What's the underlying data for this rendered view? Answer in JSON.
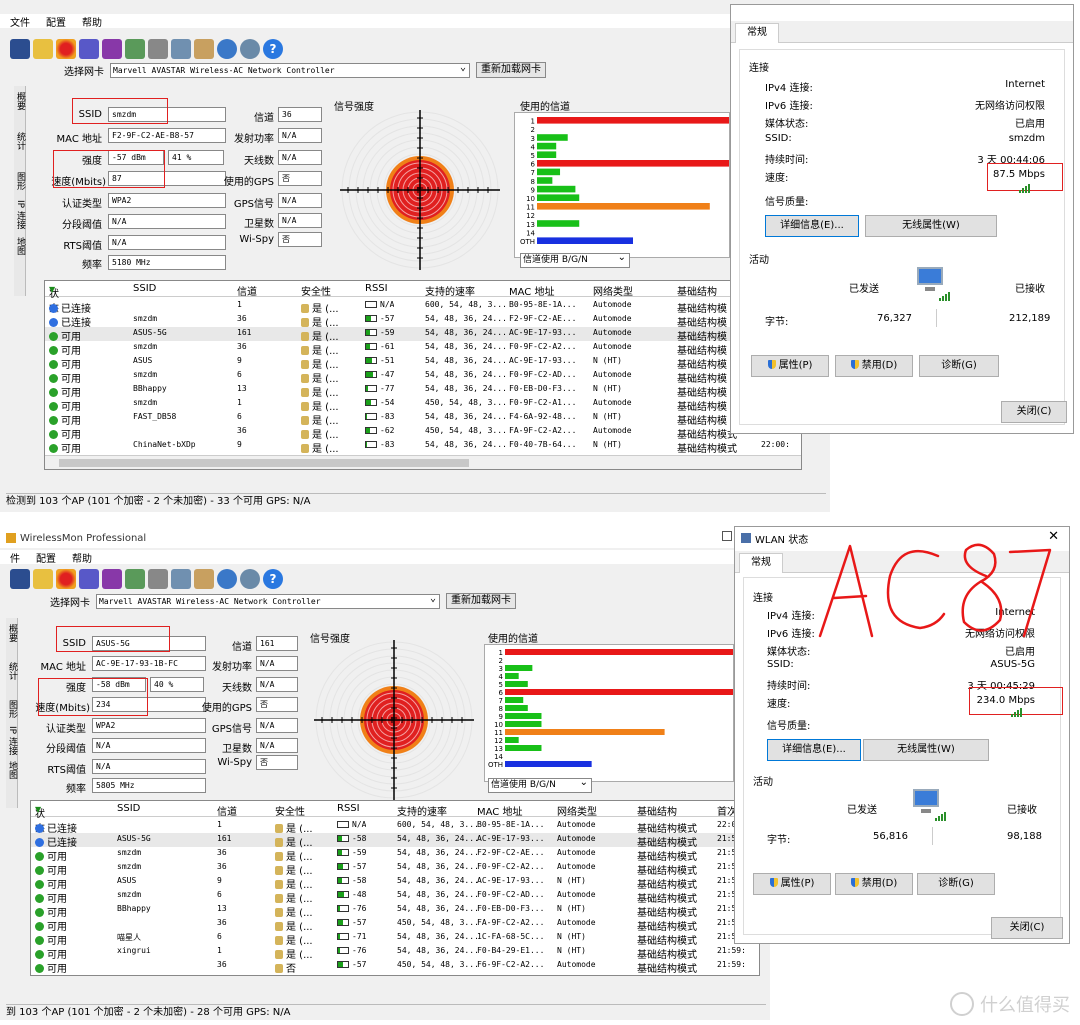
{
  "top": {
    "menu": [
      "文件",
      "配置",
      "帮助"
    ],
    "nic_label": "选择网卡",
    "nic_value": "Marvell AVASTAR Wireless-AC Network Controller",
    "reload_btn": "重新加载网卡",
    "side_tabs": [
      "概要",
      "统计",
      "图形",
      "IP 连接",
      "地图"
    ],
    "fields": {
      "ssid_l": "SSID",
      "ssid": "smzdm",
      "mac_l": "MAC 地址",
      "mac": "F2-9F-C2-AE-B8-57",
      "strength_l": "强度",
      "strength": "-57 dBm",
      "strength_pct": "41 %",
      "speed_l": "速度(Mbits)",
      "speed": "87",
      "auth_l": "认证类型",
      "auth": "WPA2",
      "frag_l": "分段阈值",
      "frag": "N/A",
      "rts_l": "RTS阈值",
      "rts": "N/A",
      "freq_l": "频率",
      "freq": "5180 MHz",
      "channel_l": "信道",
      "channel": "36",
      "txpower_l": "发射功率",
      "txpower": "N/A",
      "antenna_l": "天线数",
      "antenna": "N/A",
      "gps_use_l": "使用的GPS",
      "gps_use": "否",
      "gps_sig_l": "GPS信号",
      "gps_sig": "N/A",
      "sat_l": "卫星数",
      "sat": "N/A",
      "wispy_l": "Wi-Spy",
      "wispy": "否"
    },
    "signal_title": "信号强度",
    "channel_title": "使用的信道",
    "channel_select": "信道使用 B/G/N",
    "columns": [
      "状态",
      "SSID",
      "信道",
      "安全性",
      "RSSI",
      "支持的速率",
      "MAC 地址",
      "网络类型",
      "基础结构"
    ],
    "rows": [
      {
        "status": "已连接",
        "color": "#2f6fe0",
        "ssid": "",
        "ch": "1",
        "sec": "是 (...",
        "rssi": "N/A",
        "fill": 0,
        "rates": "600, 54, 48, 3...",
        "mac": "B0-95-8E-1A...",
        "type": "Automode",
        "infra": "基础结构模"
      },
      {
        "status": "已连接",
        "color": "#2f6fe0",
        "ssid": "smzdm",
        "ch": "36",
        "sec": "是 (...",
        "rssi": "-57",
        "fill": 0.45,
        "rates": "54, 48, 36, 24...",
        "mac": "F2-9F-C2-AE...",
        "type": "Automode",
        "infra": "基础结构模"
      },
      {
        "status": "可用",
        "color": "#2aa12a",
        "ssid": "ASUS-5G",
        "ch": "161",
        "sec": "是 (...",
        "rssi": "-59",
        "fill": 0.4,
        "rates": "54, 48, 36, 24...",
        "mac": "AC-9E-17-93...",
        "type": "Automode",
        "infra": "基础结构模"
      },
      {
        "status": "可用",
        "color": "#2aa12a",
        "ssid": "smzdm",
        "ch": "36",
        "sec": "是 (...",
        "rssi": "-61",
        "fill": 0.35,
        "rates": "54, 48, 36, 24...",
        "mac": "F0-9F-C2-A2...",
        "type": "Automode",
        "infra": "基础结构模"
      },
      {
        "status": "可用",
        "color": "#2aa12a",
        "ssid": "ASUS",
        "ch": "9",
        "sec": "是 (...",
        "rssi": "-51",
        "fill": 0.55,
        "rates": "54, 48, 36, 24...",
        "mac": "AC-9E-17-93...",
        "type": "N (HT)",
        "infra": "基础结构模"
      },
      {
        "status": "可用",
        "color": "#2aa12a",
        "ssid": "smzdm",
        "ch": "6",
        "sec": "是 (...",
        "rssi": "-47",
        "fill": 0.65,
        "rates": "54, 48, 36, 24...",
        "mac": "F0-9F-C2-AD...",
        "type": "Automode",
        "infra": "基础结构模"
      },
      {
        "status": "可用",
        "color": "#2aa12a",
        "ssid": "BBhappy",
        "ch": "13",
        "sec": "是 (...",
        "rssi": "-77",
        "fill": 0.15,
        "rates": "54, 48, 36, 24...",
        "mac": "F0-EB-D0-F3...",
        "type": "N (HT)",
        "infra": "基础结构模"
      },
      {
        "status": "可用",
        "color": "#2aa12a",
        "ssid": "smzdm",
        "ch": "1",
        "sec": "是 (...",
        "rssi": "-54",
        "fill": 0.5,
        "rates": "450, 54, 48, 3...",
        "mac": "F0-9F-C2-A1...",
        "type": "Automode",
        "infra": "基础结构模"
      },
      {
        "status": "可用",
        "color": "#2aa12a",
        "ssid": "FAST_DB58",
        "ch": "6",
        "sec": "是 (...",
        "rssi": "-83",
        "fill": 0.08,
        "rates": "54, 48, 36, 24...",
        "mac": "F4-6A-92-48...",
        "type": "N (HT)",
        "infra": "基础结构模"
      },
      {
        "status": "可用",
        "color": "#2aa12a",
        "ssid": "",
        "ch": "36",
        "sec": "是 (...",
        "rssi": "-62",
        "fill": 0.35,
        "rates": "450, 54, 48, 3...",
        "mac": "FA-9F-C2-A2...",
        "type": "Automode",
        "infra": "基础结构模式"
      },
      {
        "status": "可用",
        "color": "#2aa12a",
        "ssid": "ChinaNet-bXDp",
        "ch": "9",
        "sec": "是 (...",
        "rssi": "-83",
        "fill": 0.08,
        "rates": "54, 48, 36, 24...",
        "mac": "F0-40-7B-64...",
        "type": "N (HT)",
        "infra": "基础结构模式"
      }
    ],
    "row_time_a": "21:59:",
    "row_time_b": "22:00:",
    "status_bar": "检测到 103 个AP (101 个加密 - 2 个未加密) - 33 个可用   GPS: N/A"
  },
  "top_dialog": {
    "tab": "常规",
    "conn_title": "连接",
    "ipv4_l": "IPv4 连接:",
    "ipv4": "Internet",
    "ipv6_l": "IPv6 连接:",
    "ipv6": "无网络访问权限",
    "media_l": "媒体状态:",
    "media": "已启用",
    "ssid_l": "SSID:",
    "ssid": "smzdm",
    "dur_l": "持续时间:",
    "dur": "3 天 00:44:06",
    "speed_l": "速度:",
    "speed": "87.5 Mbps",
    "quality_l": "信号质量:",
    "details_btn": "详细信息(E)...",
    "wireless_btn": "无线属性(W)",
    "activity_title": "活动",
    "sent_l": "已发送",
    "recv_l": "已接收",
    "bytes_l": "字节:",
    "sent": "76,327",
    "recv": "212,189",
    "prop_btn": "属性(P)",
    "disable_btn": "禁用(D)",
    "diag_btn": "诊断(G)",
    "close_btn": "关闭(C)"
  },
  "bottom": {
    "title": "WirelessMon Professional",
    "menu": [
      "件",
      "配置",
      "帮助"
    ],
    "nic_label": "选择网卡",
    "nic_value": "Marvell AVASTAR Wireless-AC Network Controller",
    "reload_btn": "重新加载网卡",
    "side_tabs": [
      "概要",
      "统计",
      "图形",
      "IP 连接",
      "地图"
    ],
    "fields": {
      "ssid_l": "SSID",
      "ssid": "ASUS-5G",
      "mac_l": "MAC 地址",
      "mac": "AC-9E-17-93-1B-FC",
      "strength_l": "强度",
      "strength": "-58 dBm",
      "strength_pct": "40 %",
      "speed_l": "速度(Mbits)",
      "speed": "234",
      "auth_l": "认证类型",
      "auth": "WPA2",
      "frag_l": "分段阈值",
      "frag": "N/A",
      "rts_l": "RTS阈值",
      "rts": "N/A",
      "freq_l": "频率",
      "freq": "5805 MHz",
      "channel_l": "信道",
      "channel": "161",
      "txpower_l": "发射功率",
      "txpower": "N/A",
      "antenna_l": "天线数",
      "antenna": "N/A",
      "gps_use_l": "使用的GPS",
      "gps_use": "否",
      "gps_sig_l": "GPS信号",
      "gps_sig": "N/A",
      "sat_l": "卫星数",
      "sat": "N/A",
      "wispy_l": "Wi-Spy",
      "wispy": "否"
    },
    "signal_title": "信号强度",
    "channel_title": "使用的信道",
    "channel_select": "信道使用 B/G/N",
    "columns": [
      "状态",
      "SSID",
      "信道",
      "安全性",
      "RSSI",
      "支持的速率",
      "MAC 地址",
      "网络类型",
      "基础结构",
      "首次"
    ],
    "rows": [
      {
        "status": "已连接",
        "color": "#2f6fe0",
        "ssid": "",
        "ch": "1",
        "sec": "是 (...",
        "rssi": "N/A",
        "fill": 0,
        "rates": "600, 54, 48, 3...",
        "mac": "B0-95-8E-1A...",
        "type": "Automode",
        "infra": "基础结构模式",
        "time": "22:0"
      },
      {
        "status": "已连接",
        "color": "#2f6fe0",
        "ssid": "ASUS-5G",
        "ch": "161",
        "sec": "是 (...",
        "rssi": "-58",
        "fill": 0.42,
        "rates": "54, 48, 36, 24...",
        "mac": "AC-9E-17-93...",
        "type": "Automode",
        "infra": "基础结构模式",
        "time": "21:5"
      },
      {
        "status": "可用",
        "color": "#2aa12a",
        "ssid": "smzdm",
        "ch": "36",
        "sec": "是 (...",
        "rssi": "-59",
        "fill": 0.4,
        "rates": "54, 48, 36, 24...",
        "mac": "F2-9F-C2-AE...",
        "type": "Automode",
        "infra": "基础结构模式",
        "time": "21:5"
      },
      {
        "status": "可用",
        "color": "#2aa12a",
        "ssid": "smzdm",
        "ch": "36",
        "sec": "是 (...",
        "rssi": "-57",
        "fill": 0.45,
        "rates": "54, 48, 36, 24...",
        "mac": "F0-9F-C2-A2...",
        "type": "Automode",
        "infra": "基础结构模式",
        "time": "21:5"
      },
      {
        "status": "可用",
        "color": "#2aa12a",
        "ssid": "ASUS",
        "ch": "9",
        "sec": "是 (...",
        "rssi": "-58",
        "fill": 0.42,
        "rates": "54, 48, 36, 24...",
        "mac": "AC-9E-17-93...",
        "type": "N (HT)",
        "infra": "基础结构模式",
        "time": "21:5"
      },
      {
        "status": "可用",
        "color": "#2aa12a",
        "ssid": "smzdm",
        "ch": "6",
        "sec": "是 (...",
        "rssi": "-48",
        "fill": 0.62,
        "rates": "54, 48, 36, 24...",
        "mac": "F0-9F-C2-AD...",
        "type": "Automode",
        "infra": "基础结构模式",
        "time": "21:5"
      },
      {
        "status": "可用",
        "color": "#2aa12a",
        "ssid": "BBhappy",
        "ch": "13",
        "sec": "是 (...",
        "rssi": "-76",
        "fill": 0.15,
        "rates": "54, 48, 36, 24...",
        "mac": "F0-EB-D0-F3...",
        "type": "N (HT)",
        "infra": "基础结构模式",
        "time": "21:5"
      },
      {
        "status": "可用",
        "color": "#2aa12a",
        "ssid": "",
        "ch": "36",
        "sec": "是 (...",
        "rssi": "-57",
        "fill": 0.45,
        "rates": "450, 54, 48, 3...",
        "mac": "FA-9F-C2-A2...",
        "type": "Automode",
        "infra": "基础结构模式",
        "time": "21:5"
      },
      {
        "status": "可用",
        "color": "#2aa12a",
        "ssid": "喵星人",
        "ch": "6",
        "sec": "是 (...",
        "rssi": "-71",
        "fill": 0.2,
        "rates": "54, 48, 36, 24...",
        "mac": "1C-FA-68-5C...",
        "type": "N (HT)",
        "infra": "基础结构模式",
        "time": "21:5"
      },
      {
        "status": "可用",
        "color": "#2aa12a",
        "ssid": "xingrui",
        "ch": "1",
        "sec": "是 (...",
        "rssi": "-76",
        "fill": 0.15,
        "rates": "54, 48, 36, 24...",
        "mac": "F0-B4-29-E1...",
        "type": "N (HT)",
        "infra": "基础结构模式",
        "time": "21:59:"
      },
      {
        "status": "可用",
        "color": "#2aa12a",
        "ssid": "",
        "ch": "36",
        "sec": "否",
        "rssi": "-57",
        "fill": 0.45,
        "rates": "450, 54, 48, 3...",
        "mac": "F6-9F-C2-A2...",
        "type": "Automode",
        "infra": "基础结构模式",
        "time": "21:59:"
      }
    ],
    "status_bar": "到 103 个AP (101 个加密 - 2 个未加密) - 28 个可用   GPS: N/A"
  },
  "bottom_dialog": {
    "title": "WLAN 状态",
    "tab": "常规",
    "conn_title": "连接",
    "ipv4_l": "IPv4 连接:",
    "ipv4": "Internet",
    "ipv6_l": "IPv6 连接:",
    "ipv6": "无网络访问权限",
    "media_l": "媒体状态:",
    "media": "已启用",
    "ssid_l": "SSID:",
    "ssid": "ASUS-5G",
    "dur_l": "持续时间:",
    "dur": "3 天 00:45:29",
    "speed_l": "速度:",
    "speed": "234.0 Mbps",
    "quality_l": "信号质量:",
    "details_btn": "详细信息(E)...",
    "wireless_btn": "无线属性(W)",
    "activity_title": "活动",
    "sent_l": "已发送",
    "recv_l": "已接收",
    "bytes_l": "字节:",
    "sent": "56,816",
    "recv": "98,188",
    "prop_btn": "属性(P)",
    "disable_btn": "禁用(D)",
    "diag_btn": "诊断(G)",
    "close_btn": "关闭(C)"
  },
  "annotation": "AC87",
  "watermark": "什么值得买",
  "channels": {
    "labels": [
      "1",
      "2",
      "3",
      "4",
      "5",
      "6",
      "7",
      "8",
      "9",
      "10",
      "11",
      "12",
      "13",
      "14",
      "OTH"
    ],
    "top_widths": [
      1.0,
      0.0,
      0.16,
      0.1,
      0.1,
      1.0,
      0.12,
      0.08,
      0.2,
      0.22,
      0.9,
      0.0,
      0.22,
      0.0,
      0.5
    ],
    "top_colors": [
      "#e81818",
      "#e81818",
      "#18c018",
      "#18c018",
      "#18c018",
      "#e81818",
      "#18c018",
      "#18c018",
      "#18c018",
      "#18c018",
      "#f08018",
      "#18c018",
      "#18c018",
      "#18c018",
      "#1830e0"
    ],
    "bottom_widths": [
      1.0,
      0.0,
      0.12,
      0.06,
      0.1,
      1.0,
      0.08,
      0.1,
      0.16,
      0.16,
      0.7,
      0.06,
      0.16,
      0.0,
      0.38
    ],
    "bottom_colors": [
      "#e81818",
      "#e81818",
      "#18c018",
      "#18c018",
      "#18c018",
      "#e81818",
      "#18c018",
      "#18c018",
      "#18c018",
      "#18c018",
      "#f08018",
      "#18c018",
      "#18c018",
      "#18c018",
      "#1830e0"
    ]
  }
}
